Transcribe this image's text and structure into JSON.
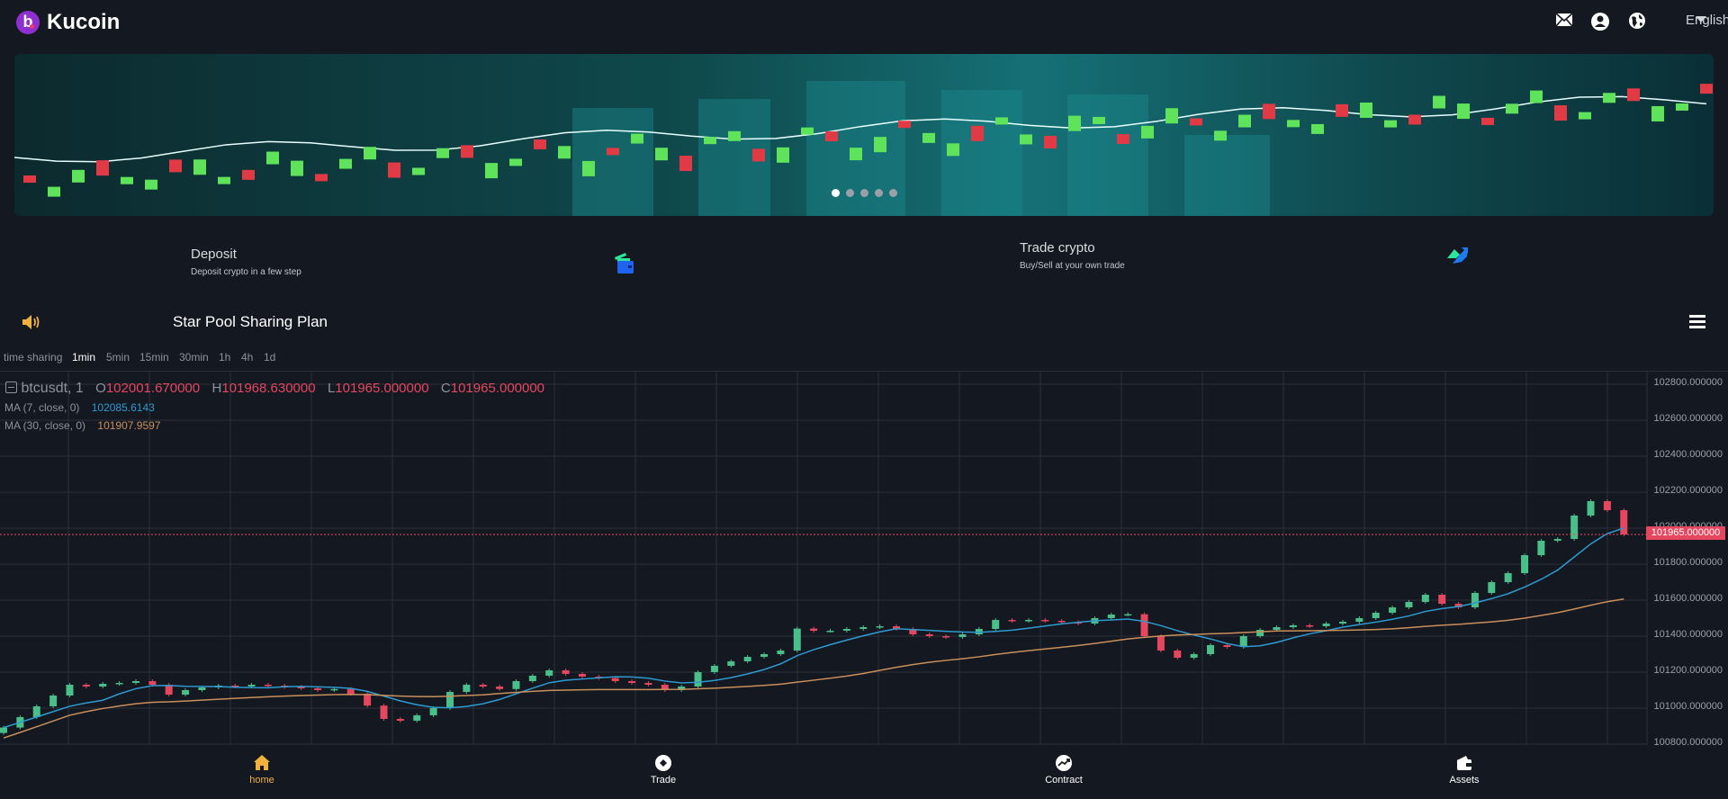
{
  "header": {
    "brand": "Kucoin",
    "logo_letter": "b",
    "language": "English",
    "icons": [
      "mail-icon",
      "user-icon",
      "globe-icon"
    ]
  },
  "banner": {
    "slides": 5,
    "active_slide": 0
  },
  "quick_actions": [
    {
      "title": "Deposit",
      "subtitle": "Deposit crypto in a few step",
      "icon": "wallet-card-icon"
    },
    {
      "title": "Trade crypto",
      "subtitle": "Buy/Sell at your own trade",
      "icon": "trade-arrows-icon"
    }
  ],
  "notice": {
    "title": "Star Pool Sharing Plan",
    "icon": "speaker-icon",
    "menu_icon": "hamburger-menu-icon"
  },
  "timeframes": {
    "items": [
      "time sharing",
      "1min",
      "5min",
      "15min",
      "30min",
      "1h",
      "4h",
      "1d"
    ],
    "active": "1min"
  },
  "chart_data": {
    "type": "candlestick",
    "symbol": "btcusdt, 1",
    "ohlc": {
      "O_label": "O",
      "O": "102001.670000",
      "H_label": "H",
      "H": "101968.630000",
      "L_label": "L",
      "L": "101965.000000",
      "C_label": "C",
      "C": "101965.000000"
    },
    "ma7": {
      "label": "MA (7, close, 0)",
      "value": "102085.6143",
      "color": "#2e9ad0"
    },
    "ma30": {
      "label": "MA (30, close, 0)",
      "value": "101907.9597",
      "color": "#c98f5a"
    },
    "last_price": "101965.000000",
    "y_ticks": [
      "102800.000000",
      "102600.000000",
      "102400.000000",
      "102200.000000",
      "102000.000000",
      "101800.000000",
      "101600.000000",
      "101400.000000",
      "101200.000000",
      "101000.000000",
      "100800.000000"
    ],
    "ylim": [
      100800,
      102800
    ],
    "up_color": "#4bbf8a",
    "down_color": "#e5475f",
    "closes": [
      100892,
      100950,
      101010,
      101070,
      101130,
      101120,
      101135,
      101140,
      101150,
      101130,
      101075,
      101100,
      101115,
      101125,
      101120,
      101130,
      101125,
      101118,
      101110,
      101100,
      101106,
      101080,
      101014,
      100940,
      100930,
      100960,
      101000,
      101090,
      101130,
      101120,
      101106,
      101150,
      101180,
      101210,
      101190,
      101175,
      101167,
      101150,
      101140,
      101130,
      101100,
      101120,
      101200,
      101235,
      101260,
      101285,
      101300,
      101320,
      101442,
      101430,
      101430,
      101440,
      101450,
      101455,
      101440,
      101410,
      101400,
      101395,
      101410,
      101440,
      101490,
      101485,
      101490,
      101485,
      101478,
      101470,
      101500,
      101520,
      101522,
      101400,
      101320,
      101280,
      101300,
      101350,
      101340,
      101400,
      101435,
      101450,
      101460,
      101455,
      101470,
      101480,
      101500,
      101530,
      101560,
      101590,
      101630,
      101580,
      101560,
      101640,
      101700,
      101750,
      101850,
      101930,
      101940,
      102070,
      102150,
      102100,
      101965
    ]
  },
  "bottom_nav": [
    {
      "label": "home",
      "icon": "home-icon",
      "active": true
    },
    {
      "label": "Trade",
      "icon": "trade-icon"
    },
    {
      "label": "Contract",
      "icon": "contract-chart-icon"
    },
    {
      "label": "Assets",
      "icon": "wallet-icon"
    }
  ],
  "colors": {
    "accent": "#f0b23d",
    "background": "#141821"
  }
}
